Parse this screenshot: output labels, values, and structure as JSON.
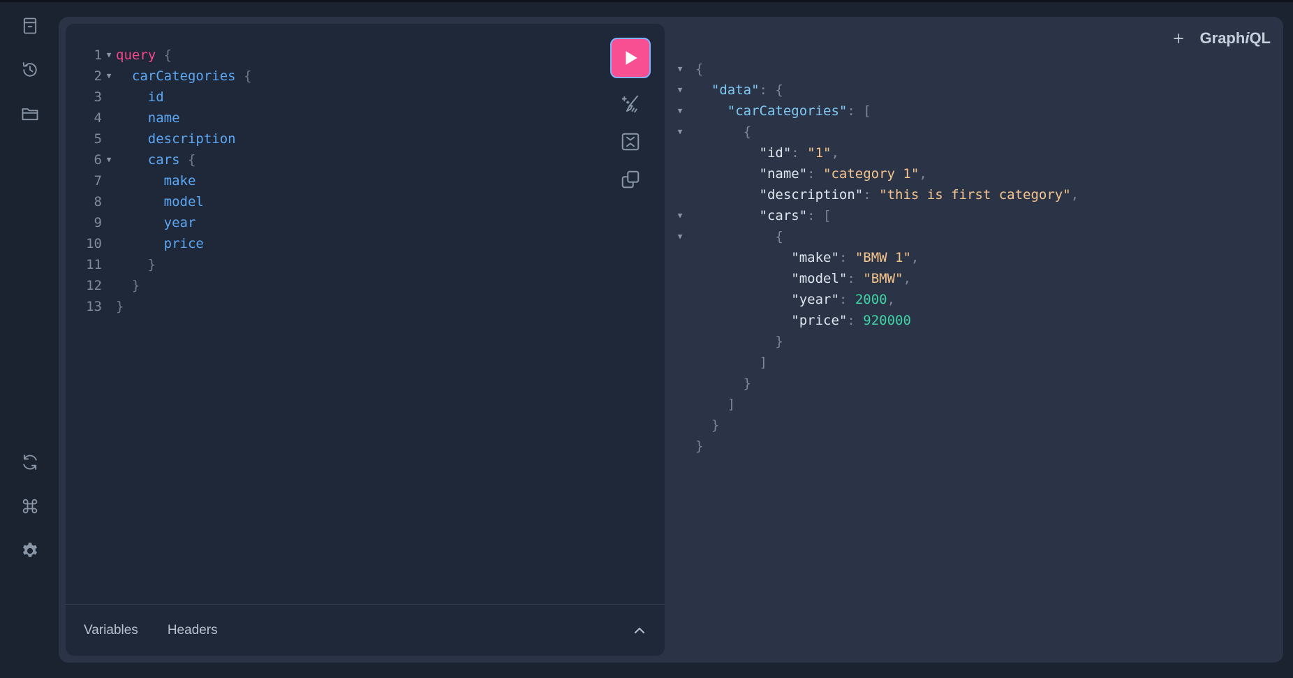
{
  "app": {
    "brand_pre": "Graph",
    "brand_i": "i",
    "brand_post": "QL"
  },
  "sidebar": {
    "top": [
      {
        "icon": "docs-icon"
      },
      {
        "icon": "history-icon"
      },
      {
        "icon": "explorer-folder-icon"
      }
    ],
    "bottom": [
      {
        "icon": "refetch-schema-icon"
      },
      {
        "icon": "shortcuts-command-icon"
      },
      {
        "icon": "settings-gear-icon"
      }
    ]
  },
  "editor": {
    "lines": [
      {
        "n": "1",
        "fold": true,
        "indent": "",
        "tokens": [
          [
            "kw",
            "query"
          ],
          [
            "sp",
            " "
          ],
          [
            "punc",
            "{"
          ]
        ]
      },
      {
        "n": "2",
        "fold": true,
        "indent": "  ",
        "tokens": [
          [
            "field",
            "carCategories"
          ],
          [
            "sp",
            " "
          ],
          [
            "punc",
            "{"
          ]
        ]
      },
      {
        "n": "3",
        "fold": false,
        "indent": "    ",
        "tokens": [
          [
            "field",
            "id"
          ]
        ]
      },
      {
        "n": "4",
        "fold": false,
        "indent": "    ",
        "tokens": [
          [
            "field",
            "name"
          ]
        ]
      },
      {
        "n": "5",
        "fold": false,
        "indent": "    ",
        "tokens": [
          [
            "field",
            "description"
          ]
        ]
      },
      {
        "n": "6",
        "fold": true,
        "indent": "    ",
        "tokens": [
          [
            "field",
            "cars"
          ],
          [
            "sp",
            " "
          ],
          [
            "punc",
            "{"
          ]
        ]
      },
      {
        "n": "7",
        "fold": false,
        "indent": "      ",
        "tokens": [
          [
            "field",
            "make"
          ]
        ]
      },
      {
        "n": "8",
        "fold": false,
        "indent": "      ",
        "tokens": [
          [
            "field",
            "model"
          ]
        ]
      },
      {
        "n": "9",
        "fold": false,
        "indent": "      ",
        "tokens": [
          [
            "field",
            "year"
          ]
        ]
      },
      {
        "n": "10",
        "fold": false,
        "indent": "      ",
        "tokens": [
          [
            "field",
            "price"
          ]
        ]
      },
      {
        "n": "11",
        "fold": false,
        "indent": "    ",
        "tokens": [
          [
            "punc",
            "}"
          ]
        ]
      },
      {
        "n": "12",
        "fold": false,
        "indent": "  ",
        "tokens": [
          [
            "punc",
            "}"
          ]
        ]
      },
      {
        "n": "13",
        "fold": false,
        "indent": "",
        "tokens": [
          [
            "punc",
            "}"
          ]
        ]
      }
    ],
    "toolbar": [
      "play-run-icon",
      "prettify-icon",
      "merge-fragments-icon",
      "copy-query-icon"
    ],
    "bottom_tabs": {
      "variables": "Variables",
      "headers": "Headers"
    }
  },
  "result": {
    "lines": [
      {
        "fold": true,
        "indent": "",
        "tokens": [
          [
            "punc",
            "{"
          ]
        ]
      },
      {
        "fold": true,
        "indent": "  ",
        "tokens": [
          [
            "key",
            "\"data\""
          ],
          [
            "punc",
            ": {"
          ]
        ]
      },
      {
        "fold": true,
        "indent": "    ",
        "tokens": [
          [
            "key",
            "\"carCategories\""
          ],
          [
            "punc",
            ": ["
          ]
        ]
      },
      {
        "fold": true,
        "indent": "      ",
        "tokens": [
          [
            "punc",
            "{"
          ]
        ]
      },
      {
        "fold": false,
        "indent": "        ",
        "tokens": [
          [
            "key2",
            "\"id\""
          ],
          [
            "punc",
            ": "
          ],
          [
            "str",
            "\"1\""
          ],
          [
            "punc",
            ","
          ]
        ]
      },
      {
        "fold": false,
        "indent": "        ",
        "tokens": [
          [
            "key2",
            "\"name\""
          ],
          [
            "punc",
            ": "
          ],
          [
            "str",
            "\"category 1\""
          ],
          [
            "punc",
            ","
          ]
        ]
      },
      {
        "fold": false,
        "indent": "        ",
        "tokens": [
          [
            "key2",
            "\"description\""
          ],
          [
            "punc",
            ": "
          ],
          [
            "str",
            "\"this is first category\""
          ],
          [
            "punc",
            ","
          ]
        ]
      },
      {
        "fold": true,
        "indent": "        ",
        "tokens": [
          [
            "key2",
            "\"cars\""
          ],
          [
            "punc",
            ": ["
          ]
        ]
      },
      {
        "fold": true,
        "indent": "          ",
        "tokens": [
          [
            "punc",
            "{"
          ]
        ]
      },
      {
        "fold": false,
        "indent": "            ",
        "tokens": [
          [
            "key2",
            "\"make\""
          ],
          [
            "punc",
            ": "
          ],
          [
            "str",
            "\"BMW 1\""
          ],
          [
            "punc",
            ","
          ]
        ]
      },
      {
        "fold": false,
        "indent": "            ",
        "tokens": [
          [
            "key2",
            "\"model\""
          ],
          [
            "punc",
            ": "
          ],
          [
            "str",
            "\"BMW\""
          ],
          [
            "punc",
            ","
          ]
        ]
      },
      {
        "fold": false,
        "indent": "            ",
        "tokens": [
          [
            "key2",
            "\"year\""
          ],
          [
            "punc",
            ": "
          ],
          [
            "num",
            "2000"
          ],
          [
            "punc",
            ","
          ]
        ]
      },
      {
        "fold": false,
        "indent": "            ",
        "tokens": [
          [
            "key2",
            "\"price\""
          ],
          [
            "punc",
            ": "
          ],
          [
            "num",
            "920000"
          ]
        ]
      },
      {
        "fold": false,
        "indent": "          ",
        "tokens": [
          [
            "punc",
            "}"
          ]
        ]
      },
      {
        "fold": false,
        "indent": "        ",
        "tokens": [
          [
            "punc",
            "]"
          ]
        ]
      },
      {
        "fold": false,
        "indent": "      ",
        "tokens": [
          [
            "punc",
            "}"
          ]
        ]
      },
      {
        "fold": false,
        "indent": "    ",
        "tokens": [
          [
            "punc",
            "]"
          ]
        ]
      },
      {
        "fold": false,
        "indent": "  ",
        "tokens": [
          [
            "punc",
            "}"
          ]
        ]
      },
      {
        "fold": false,
        "indent": "",
        "tokens": [
          [
            "punc",
            "}"
          ]
        ]
      }
    ]
  },
  "colors": {
    "background": "#1b2330",
    "panel": "#2a3446",
    "editor": "#1f2839",
    "run_button": "#f74f91",
    "keyword": "#f5478a",
    "field": "#5ba7f4",
    "string": "#f5c48c",
    "number": "#3fd3a6"
  }
}
